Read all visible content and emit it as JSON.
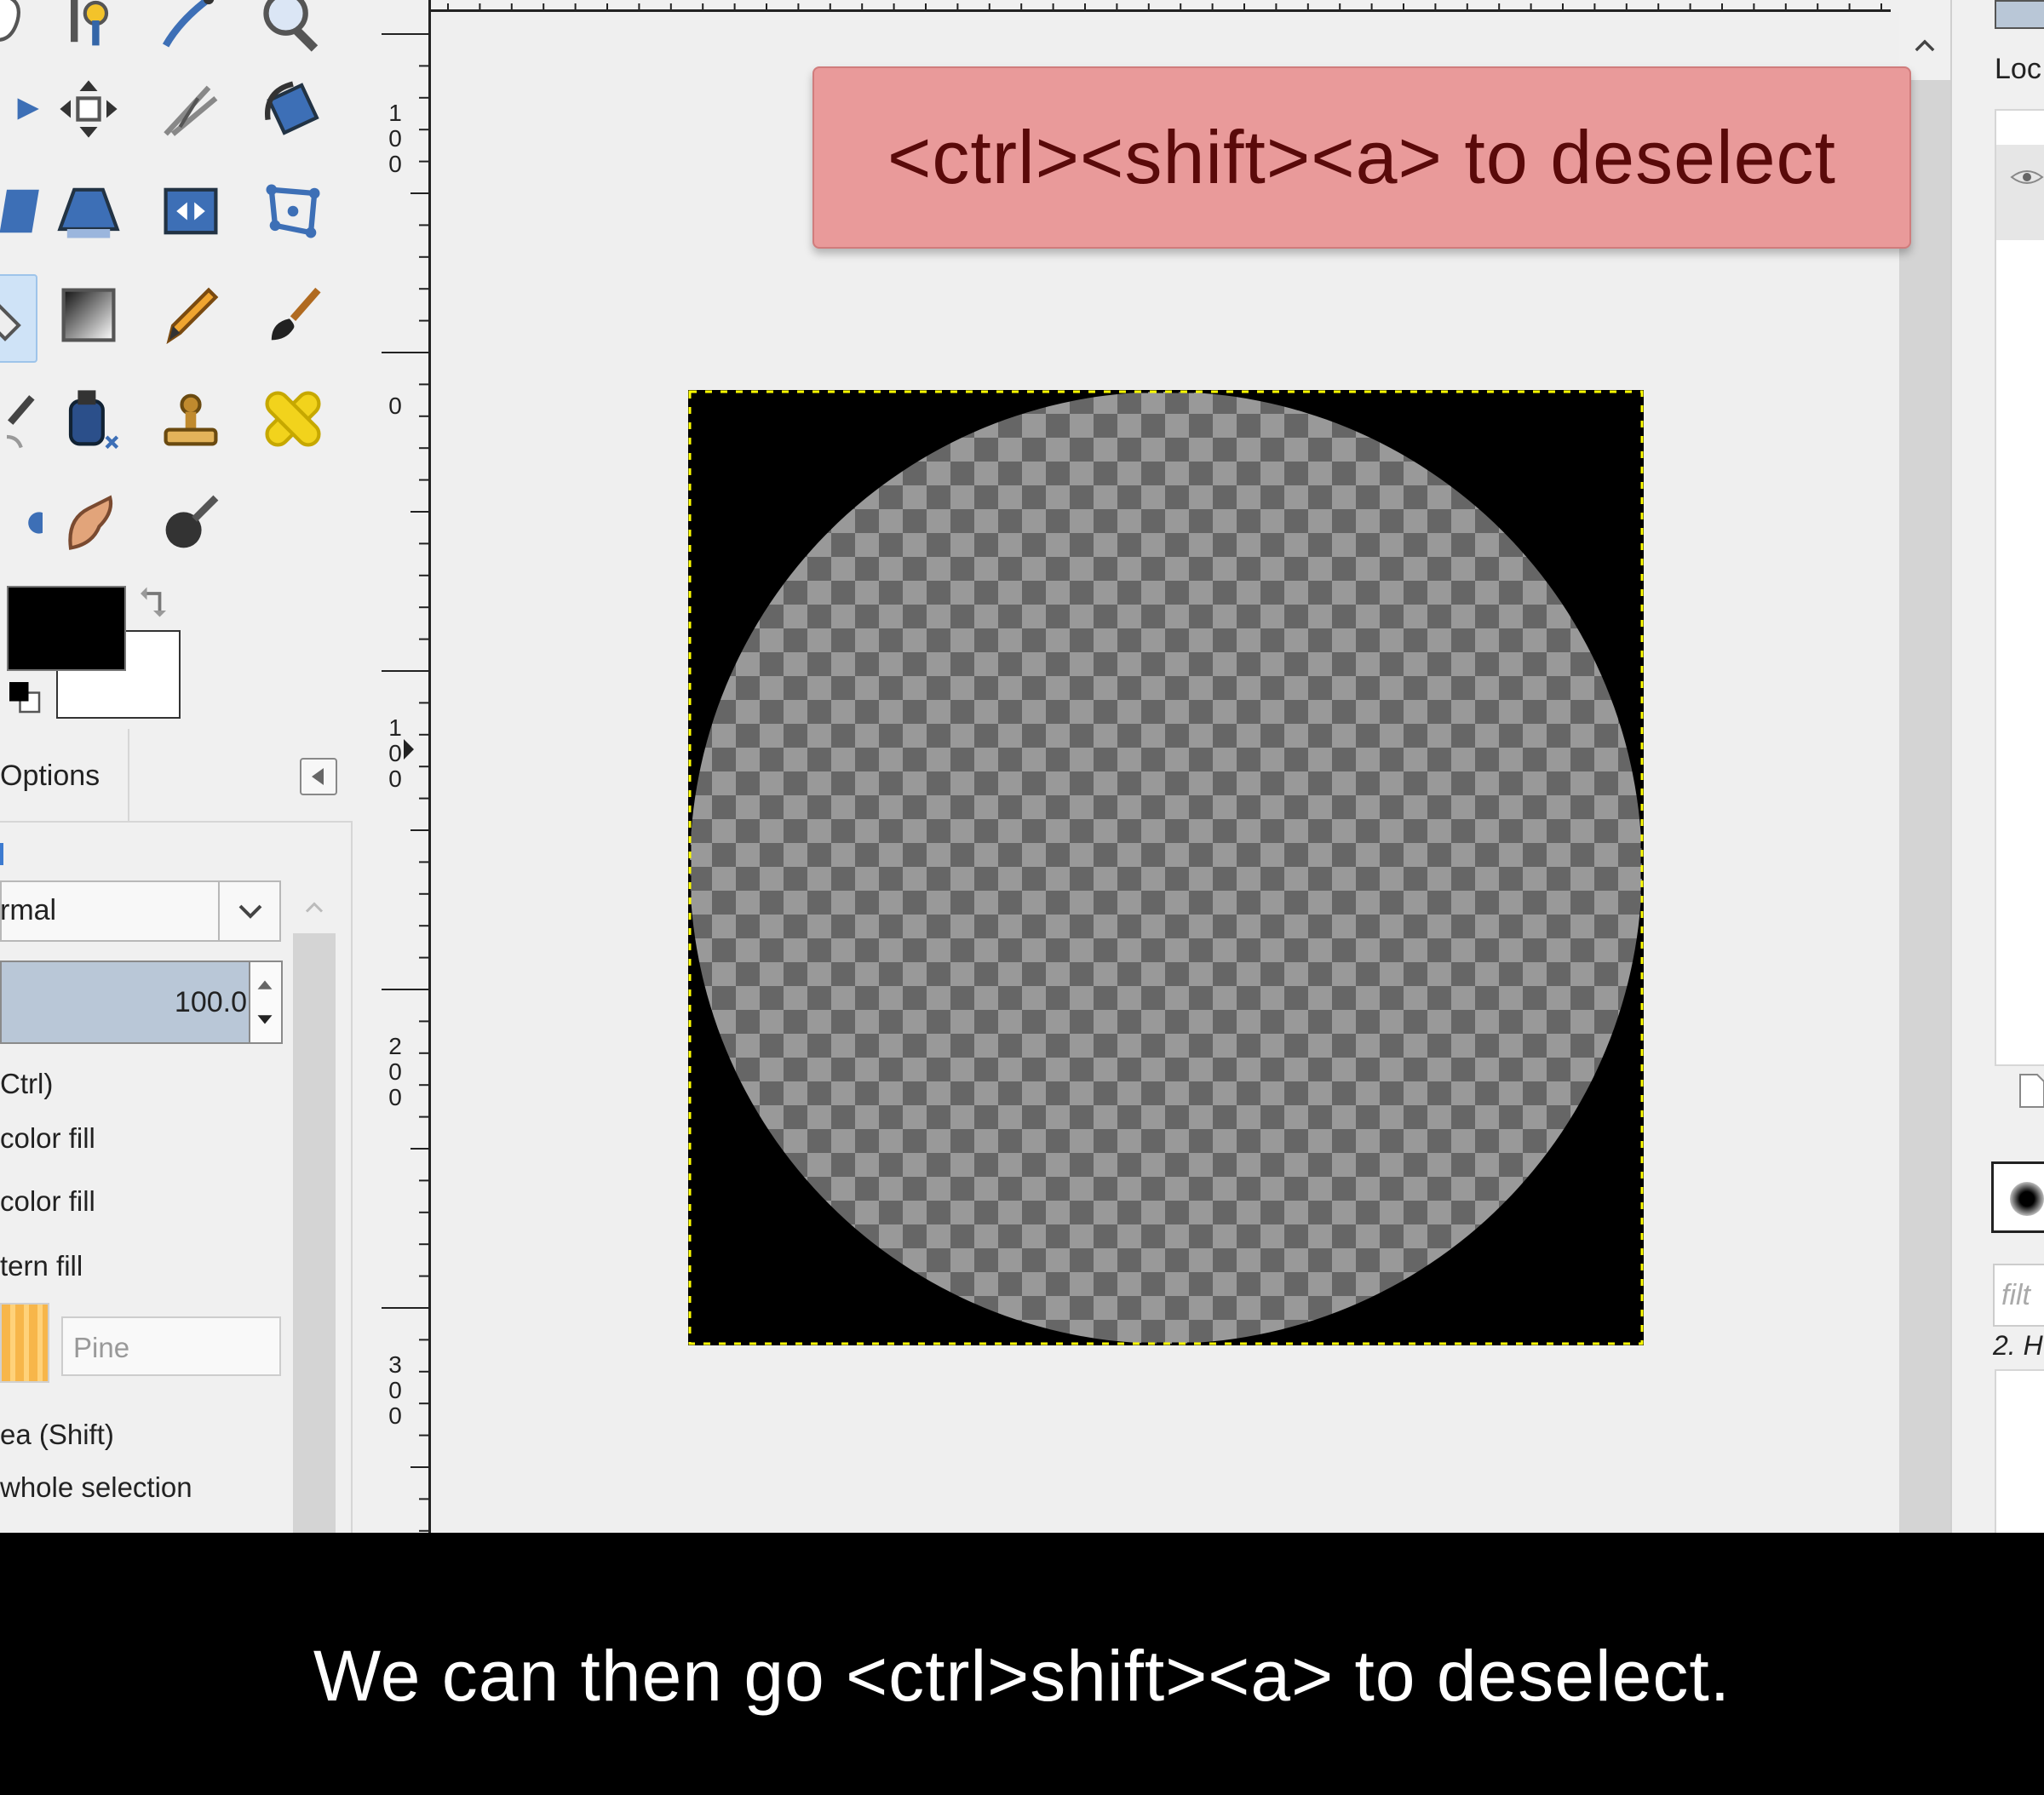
{
  "overlay": {
    "keystroke": "<ctrl><shift><a> to deselect"
  },
  "subtitle": {
    "text": "We can then go <ctrl>shift><a> to deselect."
  },
  "tool_options": {
    "tab_label": "Options",
    "mode_value": "rmal",
    "opacity_value": "100.0",
    "modifier_ctrl": "Ctrl)",
    "fill_fg": "color fill",
    "fill_bg": "color fill",
    "fill_pattern": "tern fill",
    "pattern_name": "Pine",
    "affected_area": "ea  (Shift)",
    "whole_selection": "whole selection"
  },
  "ruler": {
    "v_labels": [
      "1\n0\n0",
      "0",
      "1\n0\n0",
      "2\n0\n0",
      "3\n0\n0"
    ]
  },
  "right_dock": {
    "lock_label": "Loc",
    "filter_placeholder": "filt",
    "brush_name": "2. H"
  },
  "colors": {
    "overlay_bg": "#e99a9a",
    "overlay_text": "#5a0a0a",
    "selection_marching_ants": "#ffff00",
    "foreground": "#000000",
    "background": "#ffffff"
  },
  "icons": {
    "tools_row1": [
      "free-select-icon",
      "fuzzy-select-icon",
      "paths-icon",
      "zoom-icon"
    ],
    "tools_row2": [
      "align-icon",
      "move-icon",
      "crop-icon",
      "rotate-icon"
    ],
    "tools_row3": [
      "shear-icon",
      "perspective-icon",
      "flip-icon",
      "cage-transform-icon"
    ],
    "tools_row4": [
      "bucket-fill-icon",
      "blend-icon",
      "pencil-icon",
      "paintbrush-icon"
    ],
    "tools_row5": [
      "airbrush-icon",
      "ink-icon",
      "clone-icon",
      "heal-icon"
    ],
    "tools_row6": [
      "dodge-icon",
      "smudge-icon",
      "burn-icon"
    ]
  }
}
